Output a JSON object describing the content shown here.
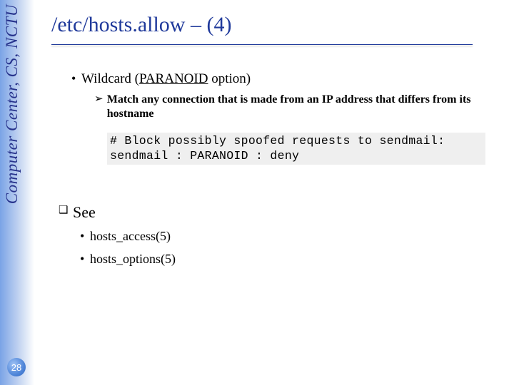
{
  "sidebar": {
    "label": "Computer Center, CS, NCTU"
  },
  "title": "/etc/hosts.allow – (4)",
  "bullet1": {
    "prefix": "Wildcard (",
    "paranoid": "PARANOID",
    "suffix": " option)"
  },
  "sub1": "Match any connection that is made from an IP address that differs from its hostname",
  "code": {
    "line1": "# Block possibly spoofed requests to sendmail:",
    "line2": "sendmail : PARANOID : deny"
  },
  "see": {
    "label": "See"
  },
  "see_items": [
    "hosts_access(5)",
    "hosts_options(5)"
  ],
  "page_number": "28"
}
